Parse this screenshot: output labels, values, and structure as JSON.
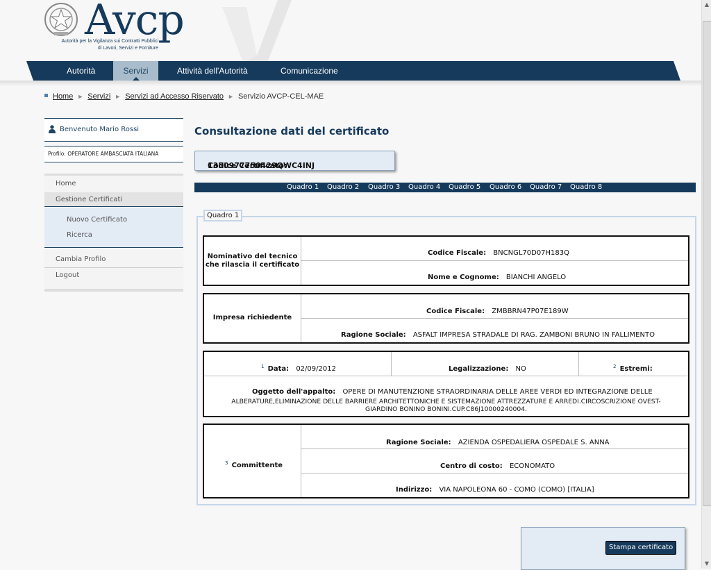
{
  "header": {
    "logo_text": "Avcp",
    "logo_subtitle_1": "Autorità per la Vigilanza sui Contratti Pubblici",
    "logo_subtitle_2": "di Lavori, Servizi e Forniture",
    "nav": [
      "Autorità",
      "Servizi",
      "Attività dell'Autorità",
      "Comunicazione"
    ],
    "nav_active": "Servizi"
  },
  "breadcrumb": {
    "items": [
      "Home",
      "Servizi",
      "Servizi ad Accesso Riservato"
    ],
    "current": "Servizio AVCP-CEL-MAE"
  },
  "sidebar": {
    "welcome": "Benvenuto Mario Rossi",
    "profile": "Profilo: OPERATORE AMBASCIATA ITALIANA",
    "menu": {
      "home": "Home",
      "gestione": "Gestione Certificati",
      "nuovo": "Nuovo Certificato",
      "ricerca": "Ricerca",
      "cambia": "Cambia Profilo",
      "logout": "Logout"
    }
  },
  "main": {
    "title": "Consultazione dati del certificato",
    "codice_label": "Codice Certificato:",
    "codice_value": "1350977750429QWC4INJ",
    "quadri": [
      "Quadro 1",
      "Quadro 2",
      "Quadro 3",
      "Quadro 4",
      "Quadro 5",
      "Quadro 6",
      "Quadro 7",
      "Quadro 8"
    ],
    "legend": "Quadro 1",
    "tecnico": {
      "label_1": "Nominativo del tecnico",
      "label_2": "che rilascia il certificato",
      "cf_label": "Codice Fiscale:",
      "cf_value": "BNCNGL70D07H183Q",
      "nome_label": "Nome e Cognome:",
      "nome_value": "BIANCHI ANGELO"
    },
    "impresa": {
      "label": "Impresa richiedente",
      "cf_label": "Codice Fiscale:",
      "cf_value": "ZMBBRN47P07E189W",
      "rs_label": "Ragione Sociale:",
      "rs_value": "ASFALT IMPRESA STRADALE DI RAG. ZAMBONI BRUNO IN FALLIMENTO"
    },
    "appalto": {
      "data_sup": "1",
      "data_label": "Data:",
      "data_value": "02/09/2012",
      "leg_label": "Legalizzazione:",
      "leg_value": "NO",
      "estremi_sup": "2",
      "estremi_label": "Estremi:",
      "oggetto_label": "Oggetto dell'appalto:",
      "oggetto_line1": "OPERE DI MANUTENZIONE STRAORDINARIA DELLE AREE VERDI ED INTEGRAZIONE DELLE",
      "oggetto_line2": "ALBERATURE,ELIMINAZIONE DELLE BARRIERE ARCHITETTONICHE E SISTEMAZIONE ATTREZZATURE E ARREDI.CIRCOSCRIZIONE OVEST-",
      "oggetto_line3": "GIARDINO BONINO BONINI.CUP.C86J10000240004."
    },
    "committente": {
      "sup": "3",
      "label": "Committente",
      "rs_label": "Ragione Sociale:",
      "rs_value": "AZIENDA OSPEDALIERA OSPEDALE S. ANNA",
      "cc_label": "Centro di costo:",
      "cc_value": "ECONOMATO",
      "ind_label": "Indirizzo:",
      "ind_value": "VIA NAPOLEONA 60 - COMO (COMO) [ITALIA]"
    },
    "stampa": "Stampa certificato"
  },
  "colors": {
    "navy": "#163a5c",
    "light_blue": "#e3ebf5"
  }
}
